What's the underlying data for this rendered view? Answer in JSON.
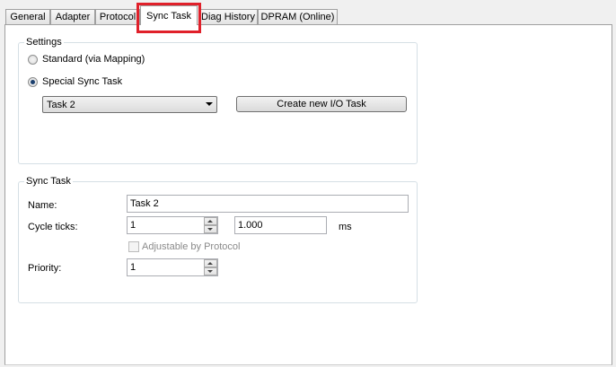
{
  "tabs": [
    {
      "label": "General",
      "active": false
    },
    {
      "label": "Adapter",
      "active": false
    },
    {
      "label": "Protocol",
      "active": false
    },
    {
      "label": "Sync Task",
      "active": true
    },
    {
      "label": "Diag History",
      "active": false
    },
    {
      "label": "DPRAM (Online)",
      "active": false
    }
  ],
  "highlight_color": "#e0202a",
  "settings": {
    "legend": "Settings",
    "option_standard": "Standard (via Mapping)",
    "option_special": "Special Sync Task",
    "selected_option": "Special Sync Task",
    "task_select_value": "Task 2",
    "create_button": "Create new I/O Task"
  },
  "sync_task": {
    "legend": "Sync Task",
    "name_label": "Name:",
    "name_value": "Task 2",
    "cycle_label": "Cycle ticks:",
    "cycle_value": "1",
    "time_value": "1.000",
    "time_unit": "ms",
    "adjustable_label": "Adjustable by Protocol",
    "adjustable_checked": false,
    "priority_label": "Priority:",
    "priority_value": "1"
  }
}
